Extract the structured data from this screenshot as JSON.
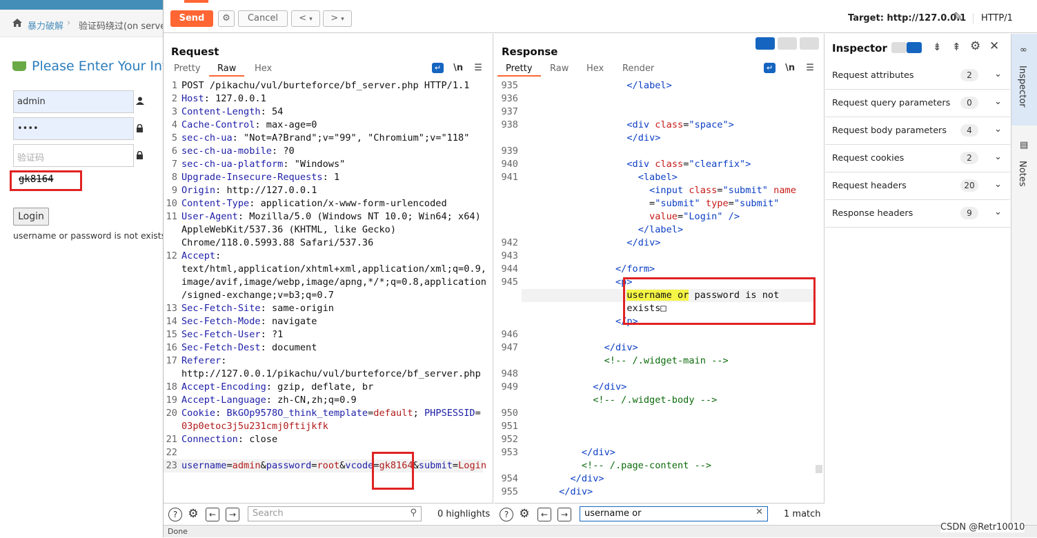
{
  "background_page": {
    "breadcrumb": [
      "暴力破解",
      "验证码绕过(on serve"
    ],
    "title": "Please Enter Your Info",
    "username_value": "admin",
    "password_value": "••••",
    "vcode_placeholder": "验证码",
    "captcha_text": "gk8164",
    "login_label": "Login",
    "message": "username or password is not exists"
  },
  "toolbar": {
    "send": "Send",
    "cancel": "Cancel",
    "back": "<",
    "forward": ">",
    "target": "Target: http://127.0.0.1",
    "protocol": "HTTP/1"
  },
  "request": {
    "title": "Request",
    "tabs": [
      "Pretty",
      "Raw",
      "Hex"
    ],
    "active_tab": "Raw",
    "search_placeholder": "Search",
    "highlights": "0 highlights"
  },
  "response": {
    "title": "Response",
    "tabs": [
      "Pretty",
      "Raw",
      "Hex",
      "Render"
    ],
    "active_tab": "Pretty",
    "search_value": "username or",
    "matches": "1 match"
  },
  "inspector": {
    "title": "Inspector",
    "rows": [
      {
        "label": "Request attributes",
        "count": "2"
      },
      {
        "label": "Request query parameters",
        "count": "0"
      },
      {
        "label": "Request body parameters",
        "count": "4"
      },
      {
        "label": "Request cookies",
        "count": "2"
      },
      {
        "label": "Request headers",
        "count": "20"
      },
      {
        "label": "Response headers",
        "count": "9"
      }
    ]
  },
  "side_tabs": [
    "Inspector",
    "Notes"
  ],
  "status": "Done",
  "watermark": "CSDN @Retr10010"
}
